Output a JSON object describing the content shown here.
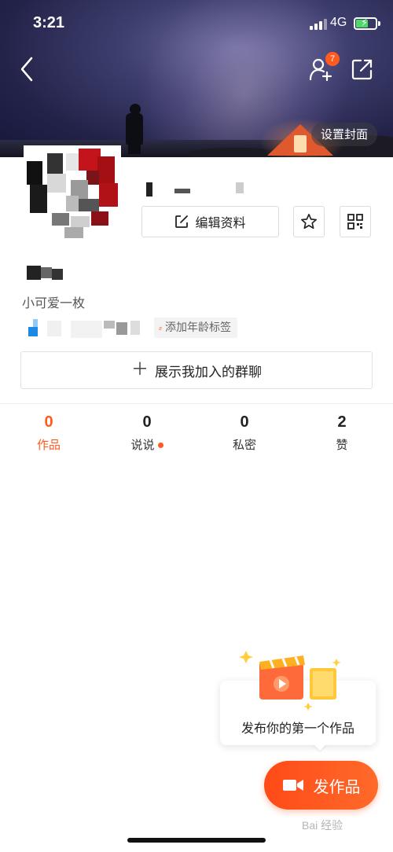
{
  "status_bar": {
    "time": "3:21",
    "network": "4G",
    "battery_fill_percent": 62
  },
  "header": {
    "friend_request_count": "7",
    "set_cover_label": "设置封面"
  },
  "profile": {
    "edit_profile_label": "编辑资料",
    "bio": "小可爱一枚",
    "age_tag_label": "添加年龄标签",
    "group_chat_label": "展示我加入的群聊"
  },
  "tabs": [
    {
      "count": "0",
      "label": "作品",
      "active": true
    },
    {
      "count": "0",
      "label": "说说",
      "has_dot": true
    },
    {
      "count": "0",
      "label": "私密"
    },
    {
      "count": "2",
      "label": "赞"
    }
  ],
  "publish": {
    "tooltip": "发布你的第一个作品",
    "button_label": "发作品"
  },
  "watermark": "Bai 经验",
  "colors": {
    "accent": "#ff5a1f",
    "badge": "#ff5a1f",
    "battery": "#4cd964"
  }
}
